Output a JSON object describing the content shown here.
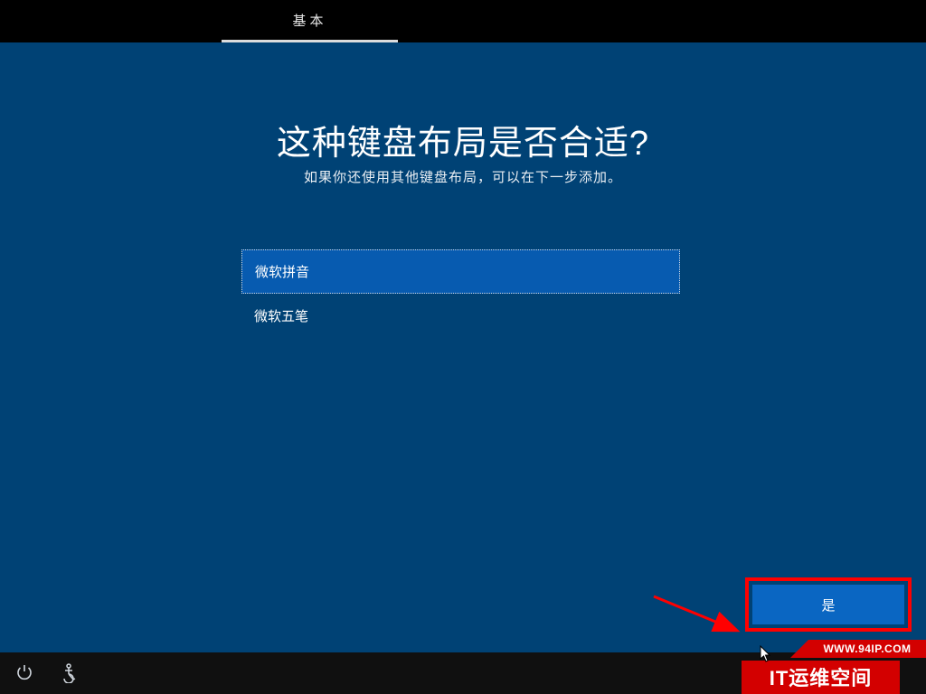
{
  "top_bar": {
    "tab_label": "基本"
  },
  "main": {
    "title": "这种键盘布局是否合适?",
    "subtitle": "如果你还使用其他键盘布局，可以在下一步添加。",
    "layouts": [
      {
        "label": "微软拼音",
        "selected": true
      },
      {
        "label": "微软五笔",
        "selected": false
      }
    ],
    "yes_button": "是"
  },
  "watermark": {
    "url": "WWW.94IP.COM",
    "name": "IT运维空间"
  }
}
